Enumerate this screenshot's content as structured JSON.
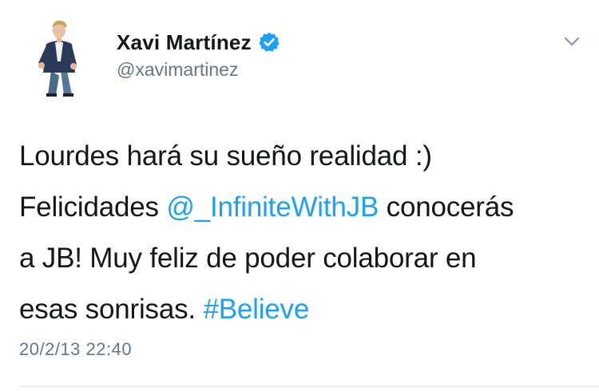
{
  "author": {
    "display_name": "Xavi Martínez",
    "handle": "@xavimartinez",
    "verified": true,
    "avatar_icon": "profile-photo-man-in-suit"
  },
  "menu": {
    "icon": "chevron-down-icon"
  },
  "tweet": {
    "line1": "Lourdes hará su sueño realidad :)",
    "line2_prefix": "Felicidades ",
    "mention": "@_InfiniteWithJB",
    "line2_suffix": " conocerás",
    "line3": "a JB! Muy feliz de poder colaborar en",
    "line4_prefix": "esas sonrisas. ",
    "hashtag": "#Believe",
    "timestamp": "20/2/13 22:40"
  },
  "colors": {
    "link": "#1da1f2",
    "text": "#14171a",
    "secondary": "#657786",
    "verified_badge": "#1da1f2"
  }
}
